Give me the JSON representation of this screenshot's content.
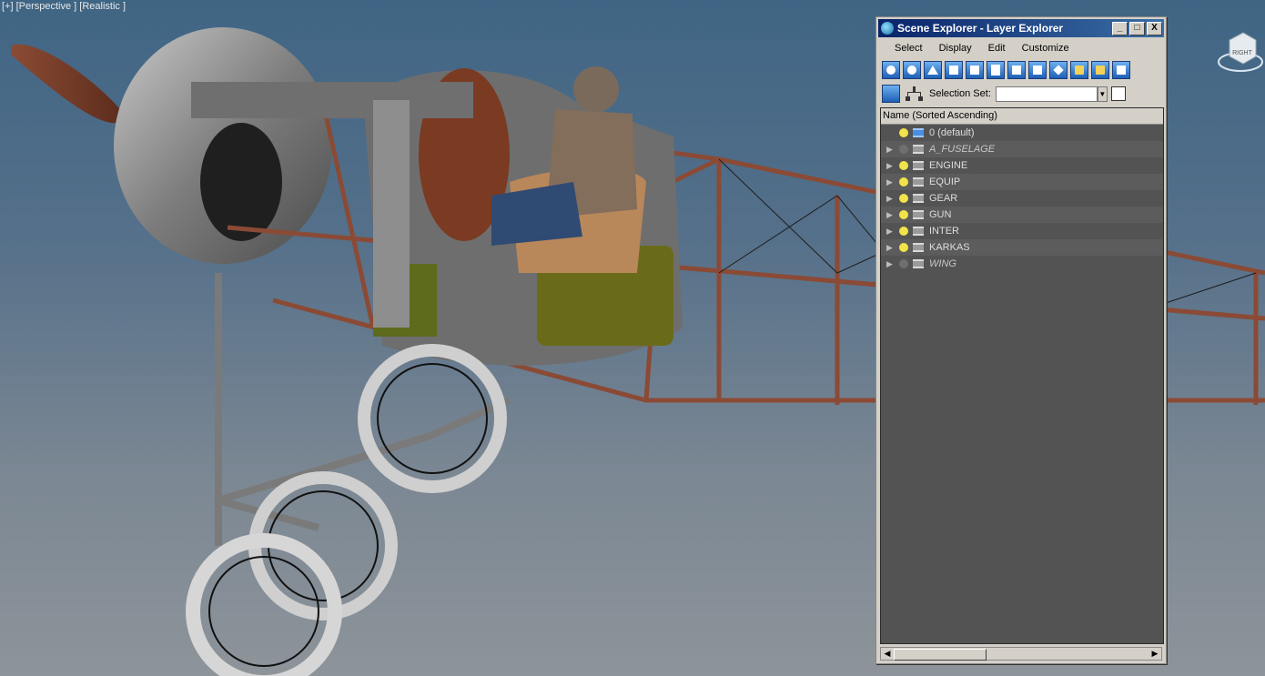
{
  "viewport": {
    "label": "[+] [Perspective ] [Realistic ]",
    "viewcube_label": "RIGHT"
  },
  "explorer": {
    "title": "Scene Explorer - Layer Explorer",
    "window_buttons": {
      "minimize": "_",
      "maximize": "□",
      "close": "X"
    },
    "menu": [
      "Select",
      "Display",
      "Edit",
      "Customize"
    ],
    "selection_set_label": "Selection Set:",
    "selection_set_value": "",
    "column_header": "Name (Sorted Ascending)",
    "layers": [
      {
        "name": "0 (default)",
        "expander": "",
        "light_on": true,
        "active": true,
        "italic": false
      },
      {
        "name": "A_FUSELAGE",
        "expander": "▶",
        "light_on": false,
        "active": false,
        "italic": true
      },
      {
        "name": "ENGINE",
        "expander": "▶",
        "light_on": true,
        "active": false,
        "italic": false
      },
      {
        "name": "EQUIP",
        "expander": "▶",
        "light_on": true,
        "active": false,
        "italic": false
      },
      {
        "name": "GEAR",
        "expander": "▶",
        "light_on": true,
        "active": false,
        "italic": false
      },
      {
        "name": "GUN",
        "expander": "▶",
        "light_on": true,
        "active": false,
        "italic": false
      },
      {
        "name": "INTER",
        "expander": "▶",
        "light_on": true,
        "active": false,
        "italic": false
      },
      {
        "name": "KARKAS",
        "expander": "▶",
        "light_on": true,
        "active": false,
        "italic": false
      },
      {
        "name": "WING",
        "expander": "▶",
        "light_on": false,
        "active": false,
        "italic": true
      }
    ],
    "toolbar_icons": [
      "display-geometry-icon",
      "display-shapes-icon",
      "display-lights-icon",
      "display-cameras-icon",
      "display-helpers-icon",
      "display-spacewarps-icon",
      "display-groups-icon",
      "display-xrefs-icon",
      "display-bones-icon",
      "display-containers-icon",
      "display-frozen-icon",
      "display-hidden-icon"
    ]
  }
}
